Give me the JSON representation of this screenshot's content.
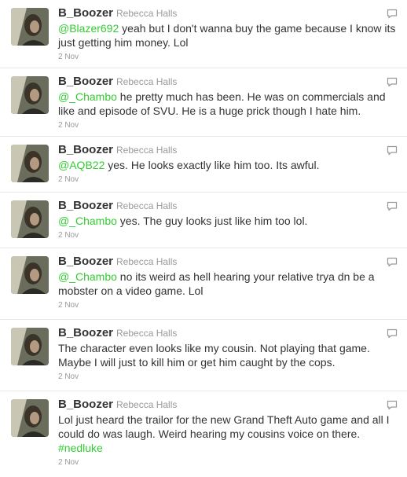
{
  "colors": {
    "link": "#33cc33",
    "text": "#333333",
    "meta": "#999999",
    "divider": "#e6e6e6"
  },
  "icons": {
    "reply": "speech-bubble-icon"
  },
  "tweets": [
    {
      "screen_name": "B_Boozer",
      "full_name": "Rebecca Halls",
      "mention": "@Blazer692",
      "body": " yeah but I don't wanna buy the game because I know its just getting him money. Lol",
      "hashtag": "",
      "time": "2 Nov"
    },
    {
      "screen_name": "B_Boozer",
      "full_name": "Rebecca Halls",
      "mention": "@_Chambo",
      "body": " he pretty much has been. He was on commercials and like and episode of SVU. He is a huge prick though I hate him.",
      "hashtag": "",
      "time": "2 Nov"
    },
    {
      "screen_name": "B_Boozer",
      "full_name": "Rebecca Halls",
      "mention": "@AQB22",
      "body": " yes. He looks exactly like him too. Its awful.",
      "hashtag": "",
      "time": "2 Nov"
    },
    {
      "screen_name": "B_Boozer",
      "full_name": "Rebecca Halls",
      "mention": "@_Chambo",
      "body": " yes. The guy looks just like him too lol.",
      "hashtag": "",
      "time": "2 Nov"
    },
    {
      "screen_name": "B_Boozer",
      "full_name": "Rebecca Halls",
      "mention": "@_Chambo",
      "body": " no its weird as hell hearing your relative trya dn be a mobster on a video game. Lol",
      "hashtag": "",
      "time": "2 Nov"
    },
    {
      "screen_name": "B_Boozer",
      "full_name": "Rebecca Halls",
      "mention": "",
      "body": "The character even looks like my cousin. Not playing that game. Maybe I will just to kill him or get him caught by the cops.",
      "hashtag": "",
      "time": "2 Nov"
    },
    {
      "screen_name": "B_Boozer",
      "full_name": "Rebecca Halls",
      "mention": "",
      "body": "Lol just heard the trailor for the new Grand Theft Auto game and all I could do was laugh. Weird hearing my cousins voice on there.",
      "hashtag": "#nedluke",
      "time": "2 Nov"
    }
  ]
}
